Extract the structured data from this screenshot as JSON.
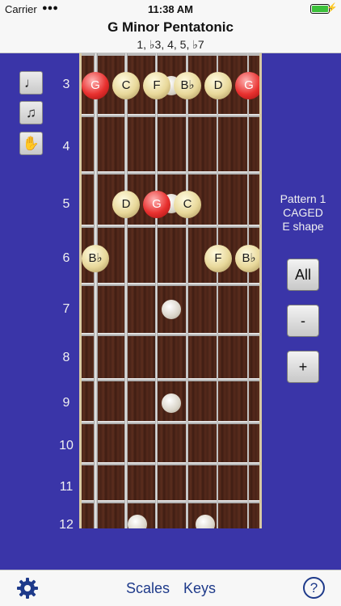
{
  "status": {
    "carrier": "Carrier",
    "time": "11:38 AM",
    "battery_level": 1.0
  },
  "header": {
    "title": "G Minor Pentatonic",
    "subtitle": "1, ♭3, 4, 5, ♭7"
  },
  "left_controls": [
    {
      "icon": "single-note-icon",
      "glyph": "♩"
    },
    {
      "icon": "double-note-icon",
      "glyph": "♫"
    },
    {
      "icon": "hand-icon",
      "glyph": "✋"
    }
  ],
  "fret_numbers": [
    "3",
    "4",
    "5",
    "6",
    "7",
    "8",
    "9",
    "10",
    "11",
    "12"
  ],
  "notes": {
    "g_f3_s6": "G",
    "c_f3_s5": "C",
    "f_f3_s4": "F",
    "bb_f3_s3": "B♭",
    "d_f3_s2": "D",
    "g_f3_s1": "G",
    "d_f5_s5": "D",
    "g_f5_s4": "G",
    "c_f5_s3": "C",
    "bb_f6_s6": "B♭",
    "f_f6_s2": "F",
    "bb_f6_s1": "B♭"
  },
  "pattern": {
    "line1": "Pattern 1",
    "line2": "CAGED",
    "line3": "E shape"
  },
  "buttons": {
    "all": "All",
    "minus": "-",
    "plus": "+"
  },
  "tabbar": {
    "scales": "Scales",
    "keys": "Keys",
    "help": "?"
  },
  "colors": {
    "background": "#3a35a8",
    "root_note": "#e8312f",
    "scale_note": "#e8d89a",
    "tab_tint": "#1e3a8a"
  }
}
